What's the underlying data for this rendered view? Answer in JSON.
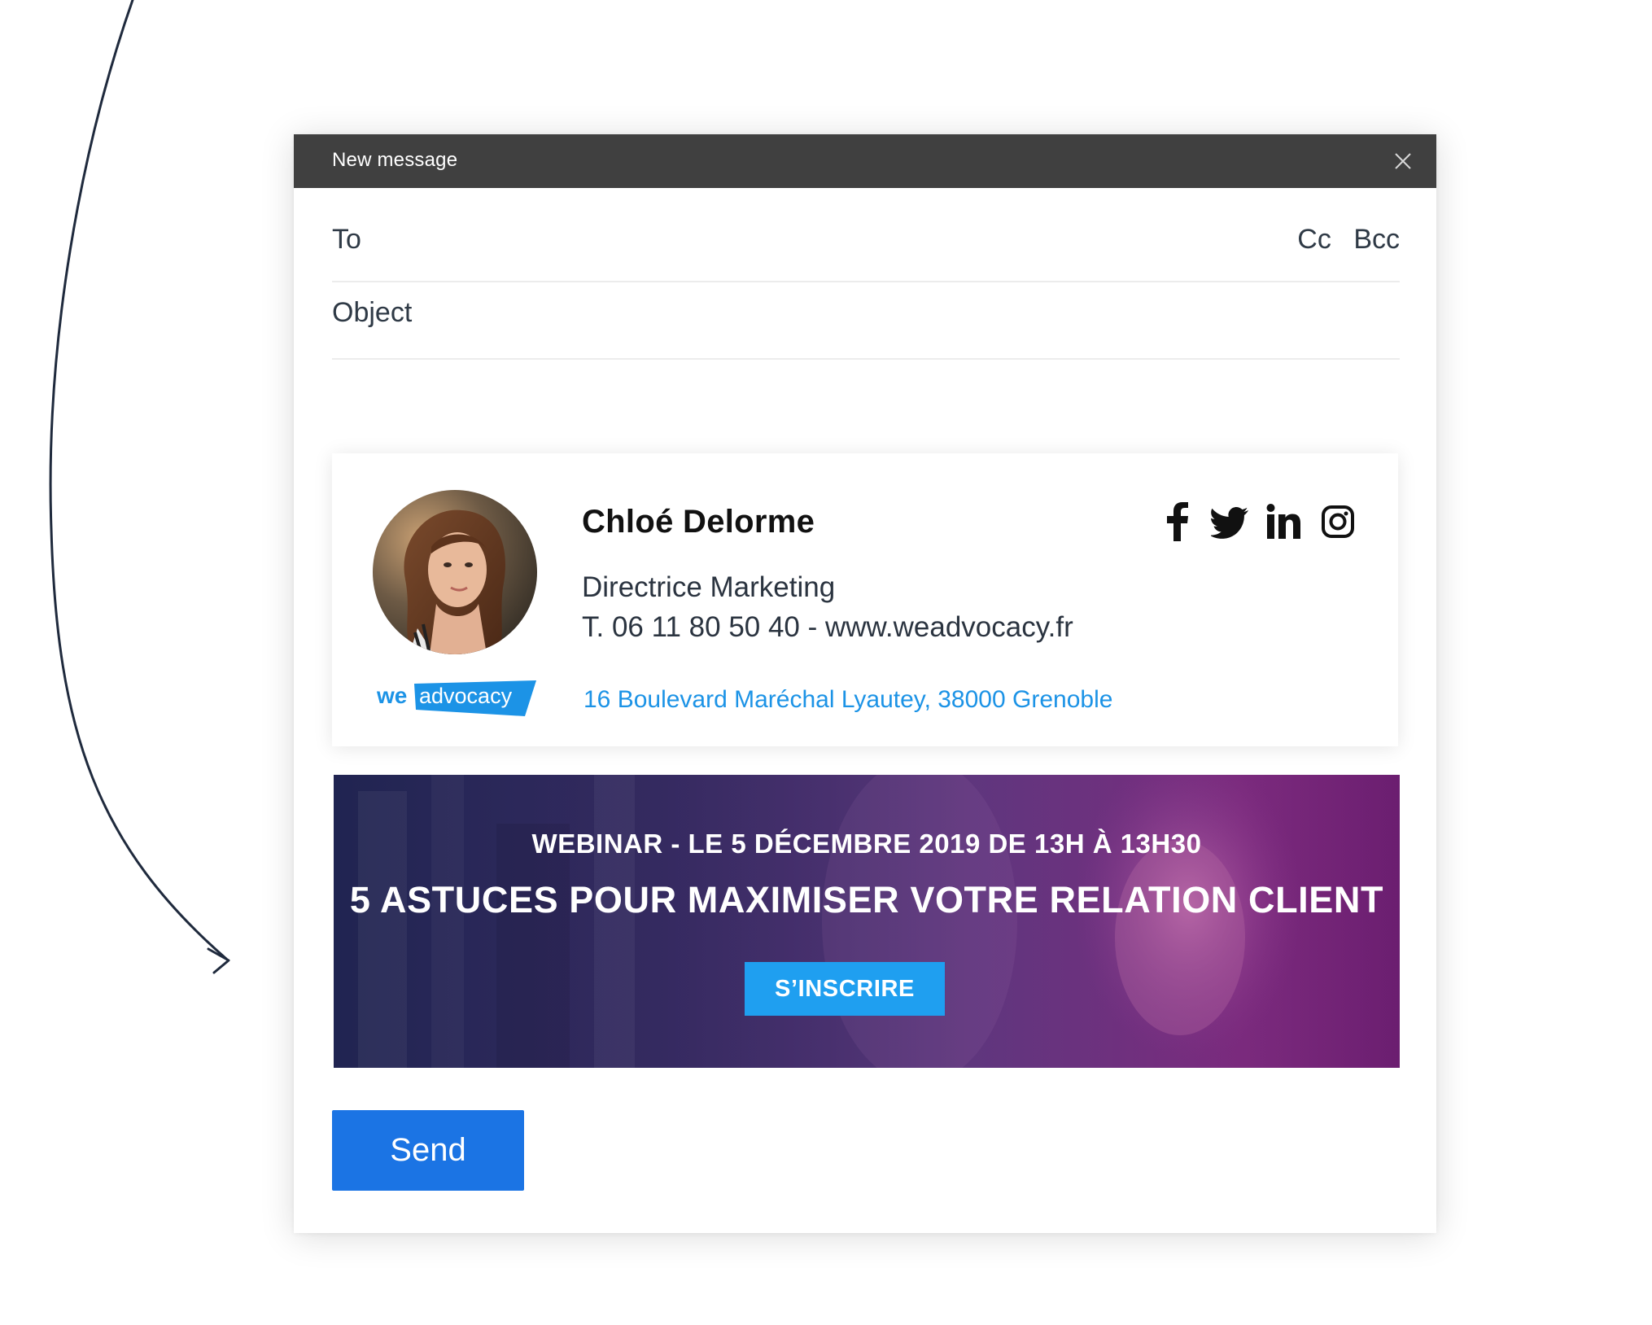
{
  "window": {
    "title": "New message",
    "close_icon": "close-icon"
  },
  "fields": {
    "to_label": "To",
    "cc_label": "Cc",
    "bcc_label": "Bcc",
    "object_label": "Object"
  },
  "signature": {
    "name": "Chloé Delorme",
    "role": "Directrice Marketing",
    "contact": "T. 06 11 80 50 40 - www.weadvocacy.fr",
    "address": "16 Boulevard Maréchal Lyautey, 38000 Grenoble",
    "logo": {
      "part1": "we",
      "part2": "advocacy"
    },
    "social_icons": [
      "facebook-icon",
      "twitter-icon",
      "linkedin-icon",
      "instagram-icon"
    ]
  },
  "banner": {
    "kicker": "WEBINAR - LE 5 DÉCEMBRE 2019 DE 13H À 13H30",
    "headline": "5 ASTUCES POUR MAXIMISER VOTRE RELATION CLIENT",
    "cta_label": "S’INSCRIRE"
  },
  "actions": {
    "send_label": "Send"
  },
  "colors": {
    "titlebar": "#404040",
    "link_blue": "#1c93e6",
    "cta_blue": "#1f9ff0",
    "send_blue": "#1b74e4",
    "banner_purple": "#6b1e70"
  }
}
